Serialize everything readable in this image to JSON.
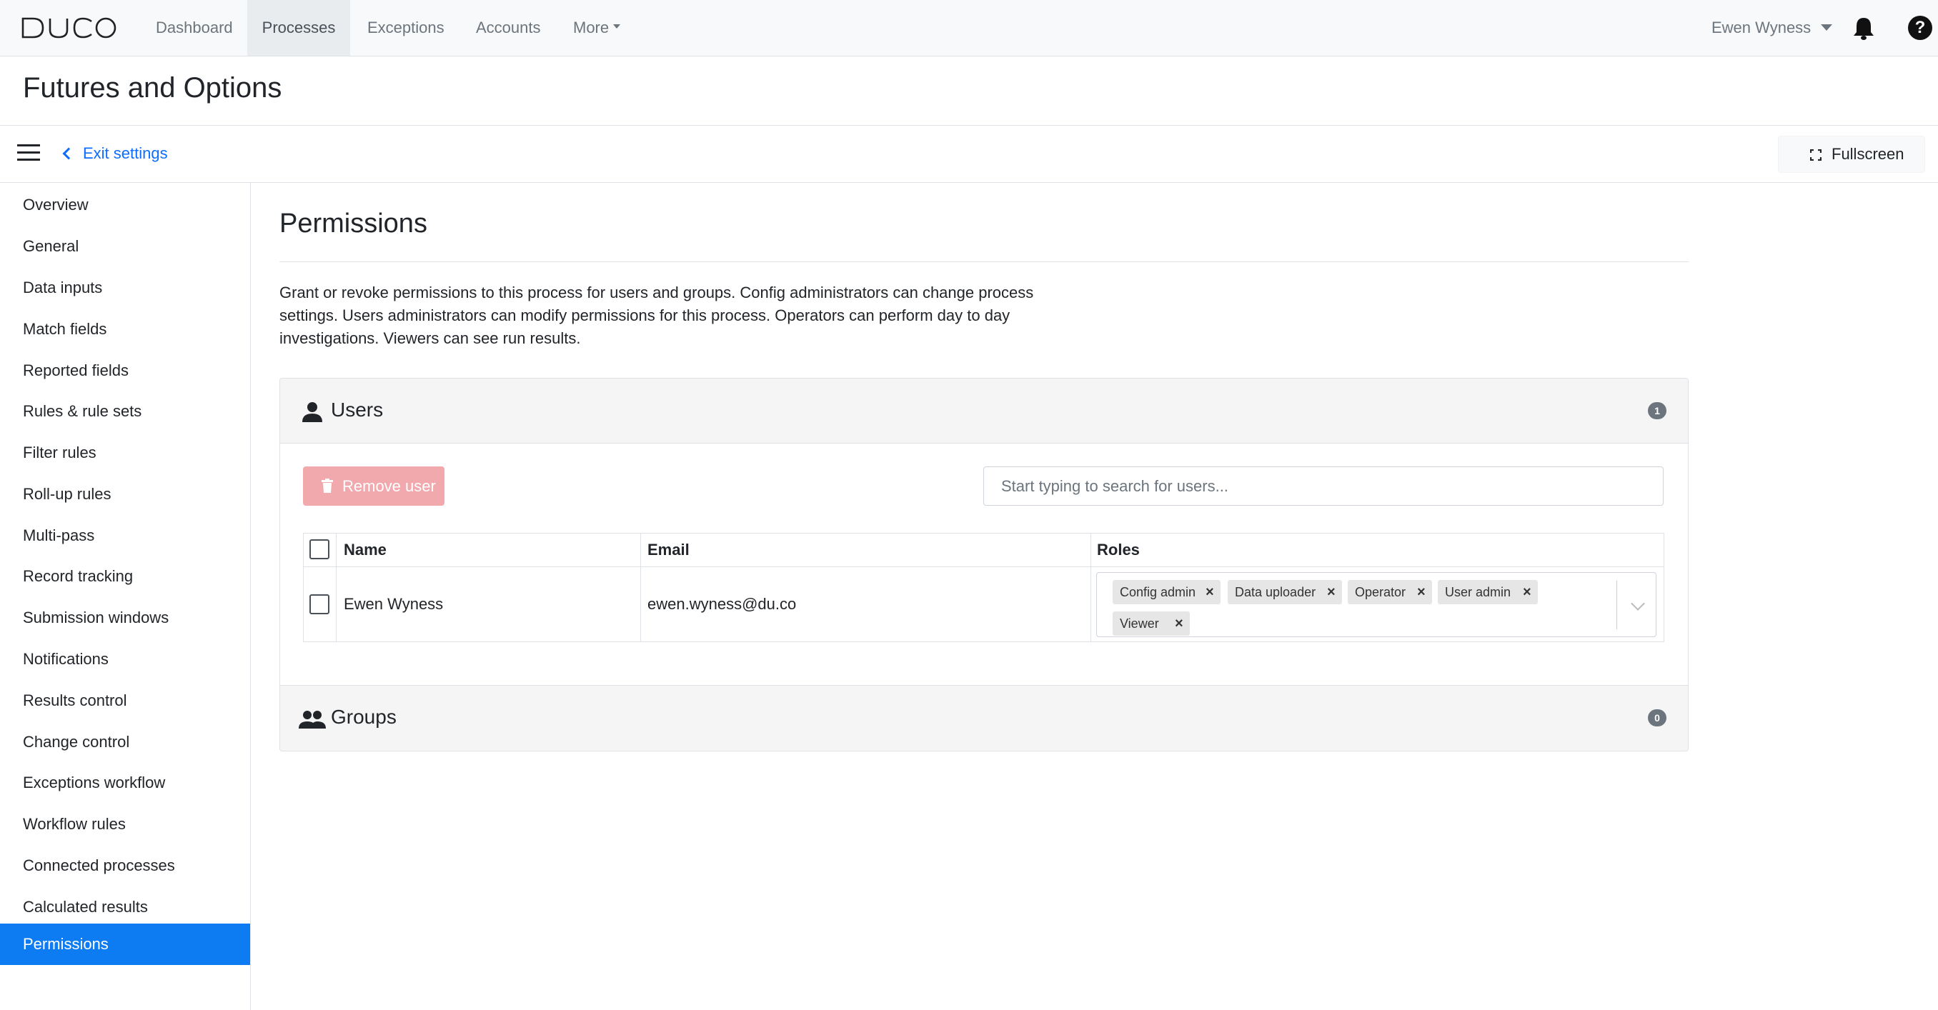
{
  "nav": {
    "logo_text": "DUCO",
    "items": [
      {
        "label": "Dashboard"
      },
      {
        "label": "Processes"
      },
      {
        "label": "Exceptions"
      },
      {
        "label": "Accounts"
      },
      {
        "label": "More"
      }
    ],
    "active_item": "Processes",
    "user_name": "Ewen Wyness",
    "help_glyph": "?"
  },
  "page": {
    "title": "Futures and Options"
  },
  "settings_bar": {
    "exit_label": "Exit settings",
    "fullscreen_label": "Fullscreen"
  },
  "sidebar": {
    "items": [
      {
        "label": "Overview"
      },
      {
        "label": "General"
      },
      {
        "label": "Data inputs"
      },
      {
        "label": "Match fields"
      },
      {
        "label": "Reported fields"
      },
      {
        "label": "Rules & rule sets"
      },
      {
        "label": "Filter rules"
      },
      {
        "label": "Roll-up rules"
      },
      {
        "label": "Multi-pass"
      },
      {
        "label": "Record tracking"
      },
      {
        "label": "Submission windows"
      },
      {
        "label": "Notifications"
      },
      {
        "label": "Results control"
      },
      {
        "label": "Change control"
      },
      {
        "label": "Exceptions workflow"
      },
      {
        "label": "Workflow rules"
      },
      {
        "label": "Connected processes"
      },
      {
        "label": "Calculated results"
      },
      {
        "label": "Permissions"
      }
    ],
    "active_item": "Permissions"
  },
  "permissions": {
    "title": "Permissions",
    "description": "Grant or revoke permissions to this process for users and groups. Config administrators can change process settings. Users administrators can modify permissions for this process. Operators can perform day to day investigations. Viewers can see run results.",
    "users": {
      "heading": "Users",
      "count": "1",
      "remove_label": "Remove user",
      "search_placeholder": "Start typing to search for users...",
      "columns": {
        "name": "Name",
        "email": "Email",
        "roles": "Roles"
      },
      "rows": [
        {
          "name": "Ewen Wyness",
          "email": "ewen.wyness@du.co",
          "checked": false,
          "roles": [
            "Config admin",
            "Data uploader",
            "Operator",
            "User admin",
            "Viewer"
          ]
        }
      ]
    },
    "groups": {
      "heading": "Groups",
      "count": "0"
    }
  },
  "colors": {
    "accent": "#0d7cf2",
    "link": "#0d6efd",
    "danger_disabled": "#f1a9ae",
    "badge": "#6c757d"
  },
  "icons": {
    "bell": "bell-icon",
    "help": "help-icon",
    "user": "user-icon",
    "groups": "groups-icon",
    "trash": "trash-icon",
    "fullscreen": "fullscreen-icon",
    "menu": "hamburger-icon"
  }
}
